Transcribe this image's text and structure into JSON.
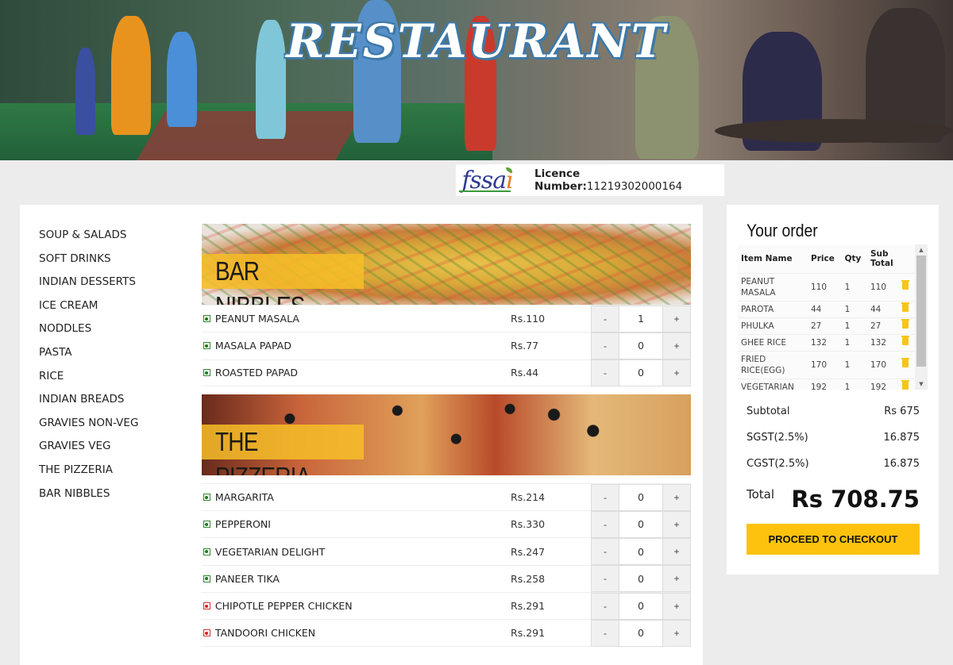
{
  "hero": {
    "title": "RESTAURANT"
  },
  "licence": {
    "logo_text_main": "fssa",
    "logo_text_accent": "i",
    "label": "Licence Number:",
    "number": "11219302000164"
  },
  "categories": [
    "SOUP & SALADS",
    "SOFT DRINKS",
    "INDIAN DESSERTS",
    "ICE CREAM",
    "NODDLES",
    "PASTA",
    "RICE",
    "INDIAN BREADS",
    "GRAVIES NON-VEG",
    "GRAVIES VEG",
    "THE PIZZERIA",
    "BAR NIBBLES"
  ],
  "sections": [
    {
      "title": "BAR NIBBLES",
      "items": [
        {
          "name": "PEANUT MASALA",
          "price": "Rs.110",
          "qty": "1",
          "veg": true
        },
        {
          "name": "MASALA PAPAD",
          "price": "Rs.77",
          "qty": "0",
          "veg": true
        },
        {
          "name": "ROASTED PAPAD",
          "price": "Rs.44",
          "qty": "0",
          "veg": true
        }
      ]
    },
    {
      "title": "THE PIZZERIA",
      "items": [
        {
          "name": "MARGARITA",
          "price": "Rs.214",
          "qty": "0",
          "veg": true
        },
        {
          "name": "PEPPERONI",
          "price": "Rs.330",
          "qty": "0",
          "veg": true
        },
        {
          "name": "VEGETARIAN DELIGHT",
          "price": "Rs.247",
          "qty": "0",
          "veg": true
        },
        {
          "name": "PANEER TIKA",
          "price": "Rs.258",
          "qty": "0",
          "veg": true
        },
        {
          "name": "CHIPOTLE PEPPER CHICKEN",
          "price": "Rs.291",
          "qty": "0",
          "veg": false
        },
        {
          "name": "TANDOORI CHICKEN",
          "price": "Rs.291",
          "qty": "0",
          "veg": false
        }
      ]
    }
  ],
  "stepper": {
    "minus": "-",
    "plus": "+"
  },
  "order": {
    "title": "Your order",
    "headers": [
      "Item Name",
      "Price",
      "Qty",
      "Sub Total"
    ],
    "rows": [
      [
        "PEANUT MASALA",
        "110",
        "1",
        "110"
      ],
      [
        "PAROTA",
        "44",
        "1",
        "44"
      ],
      [
        "PHULKA",
        "27",
        "1",
        "27"
      ],
      [
        "GHEE RICE",
        "132",
        "1",
        "132"
      ],
      [
        "FRIED RICE(EGG)",
        "170",
        "1",
        "170"
      ],
      [
        "VEGETARIAN",
        "192",
        "1",
        "192"
      ]
    ],
    "subtotal_label": "Subtotal",
    "subtotal_value": "Rs 675",
    "sgst_label": "SGST(2.5%)",
    "sgst_value": "16.875",
    "cgst_label": "CGST(2.5%)",
    "cgst_value": "16.875",
    "total_label": "Total",
    "total_value": "Rs 708.75",
    "checkout_label": "PROCEED TO CHECKOUT"
  },
  "colors": {
    "accent": "#fdc20e",
    "veg": "#1c7a1c",
    "nonveg": "#d62020"
  }
}
